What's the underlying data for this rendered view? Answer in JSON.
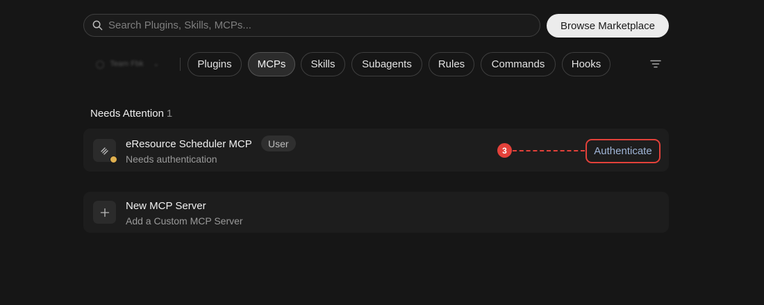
{
  "search": {
    "placeholder": "Search Plugins, Skills, MCPs...",
    "value": ""
  },
  "header": {
    "browse_label": "Browse Marketplace"
  },
  "filters": {
    "scope_label": "Team Fbk",
    "tabs": [
      {
        "label": "Plugins",
        "active": false
      },
      {
        "label": "MCPs",
        "active": true
      },
      {
        "label": "Skills",
        "active": false
      },
      {
        "label": "Subagents",
        "active": false
      },
      {
        "label": "Rules",
        "active": false
      },
      {
        "label": "Commands",
        "active": false
      },
      {
        "label": "Hooks",
        "active": false
      }
    ]
  },
  "section": {
    "title": "Needs Attention",
    "count": "1"
  },
  "attention_item": {
    "title": "eResource Scheduler MCP",
    "badge": "User",
    "subtitle": "Needs authentication",
    "action_label": "Authenticate",
    "step_marker": "3",
    "status_color": "#e0b04f"
  },
  "new_server": {
    "title": "New MCP Server",
    "subtitle": "Add a Custom MCP Server"
  },
  "colors": {
    "annotation": "#e3413a",
    "link": "#9fb4d6"
  }
}
